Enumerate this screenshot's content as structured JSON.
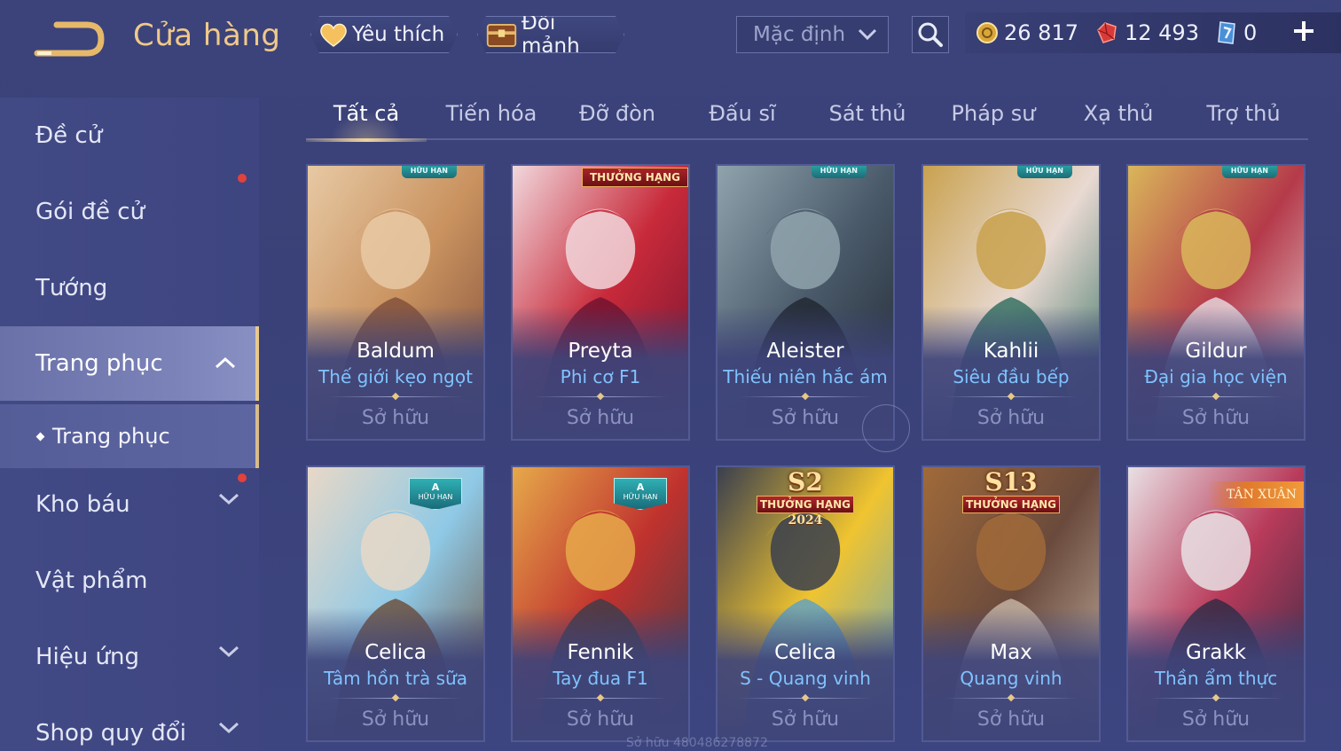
{
  "header": {
    "title": "Cửa hàng",
    "favorite_label": "Yêu thích",
    "shard_label": "Đổi mảnh",
    "sort_value": "Mặc định",
    "currencies": [
      {
        "icon": "gold-coin-icon",
        "value": "26 817"
      },
      {
        "icon": "ruby-icon",
        "value": "12 493"
      },
      {
        "icon": "voucher-icon",
        "value": "0"
      }
    ]
  },
  "sidebar": {
    "items": [
      {
        "label": "Đề cử"
      },
      {
        "label": "Gói đề cử",
        "notify": true
      },
      {
        "label": "Tướng"
      },
      {
        "label": "Trang phục",
        "expanded": true,
        "active": true
      },
      {
        "label": "Kho báu",
        "notify": true
      },
      {
        "label": "Vật phẩm"
      },
      {
        "label": "Hiệu ứng"
      },
      {
        "label": "Shop quy đổi"
      }
    ],
    "sub_item": {
      "label": "Trang phục"
    }
  },
  "tabs": [
    {
      "label": "Tất cả",
      "active": true
    },
    {
      "label": "Tiến hóa"
    },
    {
      "label": "Đỡ đòn"
    },
    {
      "label": "Đấu sĩ"
    },
    {
      "label": "Sát thủ"
    },
    {
      "label": "Pháp sư"
    },
    {
      "label": "Xạ thủ"
    },
    {
      "label": "Trợ thủ"
    }
  ],
  "cards": [
    {
      "hero": "Baldum",
      "skin": "Thế giới kẹo ngọt",
      "status": "Sở hữu",
      "badge": "HỮU HẠN",
      "badge_type": "limited",
      "palette": [
        "#c9925f",
        "#7e4d3a",
        "#e7c9a4"
      ]
    },
    {
      "hero": "Preyta",
      "skin": "Phi cơ F1",
      "status": "Sở hữu",
      "badge": "THƯỞNG HẠNG",
      "badge_type": "rank",
      "palette": [
        "#c82a3a",
        "#6d1230",
        "#f1d7dc"
      ]
    },
    {
      "hero": "Aleister",
      "skin": "Thiếu niên hắc ám",
      "status": "Sở hữu",
      "badge": "HỮU HẠN",
      "badge_type": "limited",
      "palette": [
        "#4a5a6a",
        "#1f262f",
        "#8fa3ad"
      ]
    },
    {
      "hero": "Kahlii",
      "skin": "Siêu đầu bếp",
      "status": "Sở hữu",
      "badge": "HỮU HẠN",
      "badge_type": "limited",
      "palette": [
        "#e8d9d2",
        "#2b6a5a",
        "#c9a24f"
      ]
    },
    {
      "hero": "Gildur",
      "skin": "Đại gia học viện",
      "status": "Sở hữu",
      "badge": "HỮU HẠN",
      "badge_type": "limited",
      "palette": [
        "#b53a4a",
        "#e9dfe3",
        "#d9b65a"
      ]
    },
    {
      "hero": "Celica",
      "skin": "Tâm hồn trà sữa",
      "status": "Sở hữu",
      "badge": "HỮU HẠN",
      "badge_letter": "A",
      "badge_type": "a",
      "palette": [
        "#8fc9e6",
        "#6a4a34",
        "#e8d8c7"
      ]
    },
    {
      "hero": "Fennik",
      "skin": "Tay đua F1",
      "status": "Sở hữu",
      "badge": "HỮU HẠN",
      "badge_letter": "A",
      "badge_type": "a",
      "palette": [
        "#c0322e",
        "#3a3c4a",
        "#e6a94a"
      ]
    },
    {
      "hero": "Celica",
      "skin": "S - Quang vinh",
      "status": "Sở hữu",
      "badge_season": "S2",
      "badge": "THƯỞNG HẠNG",
      "badge_year": "2024",
      "badge_type": "season",
      "palette": [
        "#f0c430",
        "#5aa0c8",
        "#3a3f4e"
      ]
    },
    {
      "hero": "Max",
      "skin": "Quang vinh",
      "status": "Sở hữu",
      "badge_season": "S13",
      "badge": "THƯỞNG HẠNG",
      "badge_type": "season",
      "palette": [
        "#6a4a3c",
        "#c9b8a8",
        "#a06a3a"
      ]
    },
    {
      "hero": "Grakk",
      "skin": "Thần ẩm thực",
      "status": "Sở hữu",
      "badge": "TÂN XUÂN",
      "badge_type": "tet",
      "palette": [
        "#b83a5a",
        "#2a2a44",
        "#e9e0e4"
      ]
    }
  ],
  "watermark": "Sở hữu 480486278872",
  "colors": {
    "accent_gold": "#f0c98a",
    "skin_name": "#7fc3ff",
    "notify_dot": "#e2413c"
  }
}
